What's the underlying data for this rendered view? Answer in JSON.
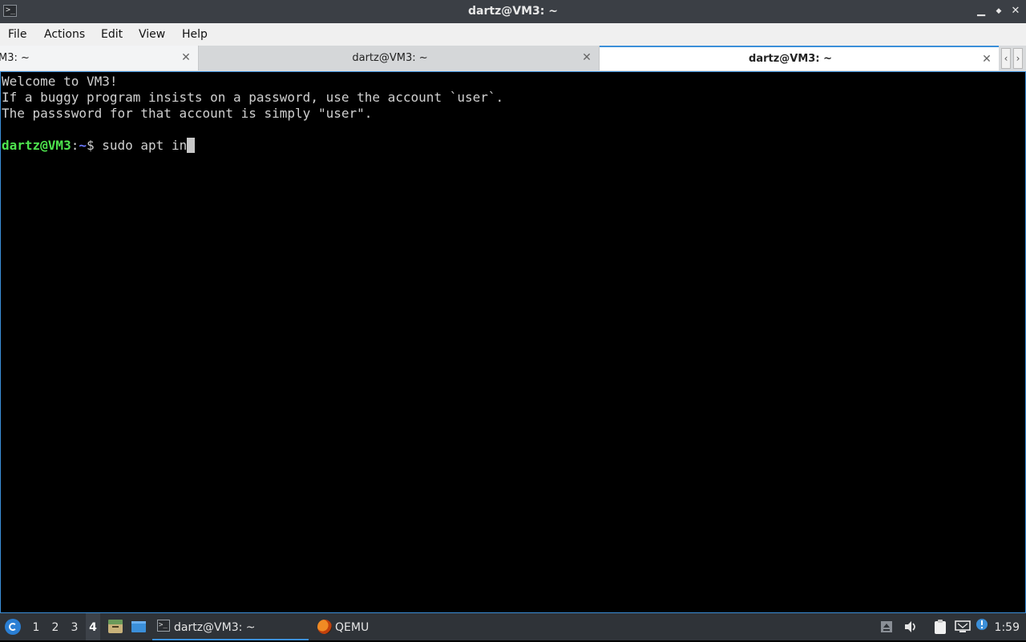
{
  "window": {
    "title": "dartz@VM3: ~",
    "controls": {
      "minimize": "▁",
      "maximize": "◆",
      "close": "✕"
    }
  },
  "menu": [
    "File",
    "Actions",
    "Edit",
    "View",
    "Help"
  ],
  "tabs": [
    {
      "label": "M3: ~",
      "active": false
    },
    {
      "label": "dartz@VM3: ~",
      "active": false
    },
    {
      "label": "dartz@VM3: ~",
      "active": true
    }
  ],
  "tab_close_glyph": "✕",
  "tab_scroll": {
    "left": "‹",
    "right": "›"
  },
  "terminal": {
    "lines": [
      "Welcome to VM3!",
      "If a buggy program insists on a password, use the account `user`.",
      "The passsword for that account is simply \"user\"."
    ],
    "prompt": {
      "user_host": "dartz@VM3",
      "separator": ":",
      "path": "~",
      "symbol": "$ ",
      "input": "sudo apt in"
    },
    "colors": {
      "background": "#000000",
      "text": "#d0d0d0",
      "user": "#4ee44e",
      "path": "#6b78ff"
    }
  },
  "taskbar": {
    "workspaces": [
      "1",
      "2",
      "3",
      "4"
    ],
    "active_workspace": "4",
    "tasks": [
      {
        "label": "dartz@VM3: ~",
        "icon": "terminal-icon",
        "active": true
      },
      {
        "label": "QEMU",
        "icon": "qemu-icon",
        "active": false
      }
    ],
    "clock": "1:59"
  },
  "accent_color": "#3b8fd9"
}
